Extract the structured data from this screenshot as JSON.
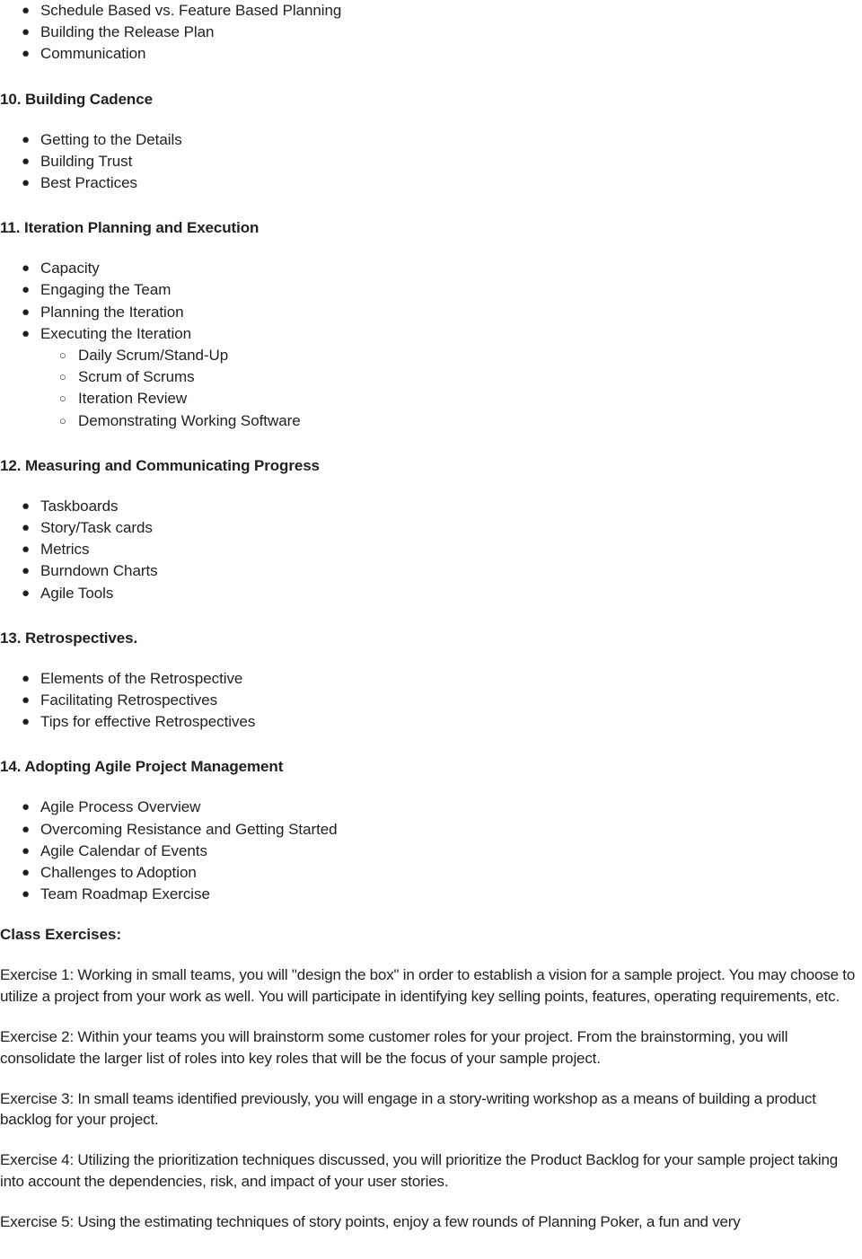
{
  "document": {
    "type": "course-outline-page",
    "bullet_glyph": "bullet-filled-circle",
    "subbullet_glyph": "bullet-hollow-circle",
    "text_color": "#231f20",
    "background_color": "#ffffff"
  },
  "top_list": {
    "items": [
      "Schedule Based vs. Feature Based Planning",
      "Building the Release Plan",
      "Communication"
    ]
  },
  "sections": [
    {
      "heading": "10. Building Cadence",
      "items": [
        "Getting to the Details",
        "Building Trust",
        "Best Practices"
      ]
    },
    {
      "heading": "11. Iteration Planning and Execution",
      "items": [
        "Capacity",
        "Engaging the Team",
        "Planning the Iteration",
        "Executing the Iteration"
      ],
      "subitems": [
        "Daily Scrum/Stand-Up",
        "Scrum of Scrums",
        "Iteration Review",
        "Demonstrating Working Software"
      ]
    },
    {
      "heading": "12. Measuring and Communicating Progress",
      "items": [
        "Taskboards",
        "Story/Task cards",
        "Metrics",
        "Burndown Charts",
        "Agile Tools"
      ]
    },
    {
      "heading": "13. Retrospectives.",
      "items": [
        "Elements of the Retrospective",
        "Facilitating Retrospectives",
        "Tips for effective Retrospectives"
      ]
    },
    {
      "heading": "14. Adopting Agile Project Management",
      "items": [
        "Agile Process Overview",
        "Overcoming Resistance and Getting Started",
        "Agile Calendar of Events",
        "Challenges to Adoption",
        "Team Roadmap Exercise"
      ]
    }
  ],
  "exercises": {
    "heading": "Class Exercises:",
    "items": [
      "Exercise 1: Working in small teams, you will \"design the box\" in order to establish a vision for a sample project. You may choose to utilize a project from your work as well. You will participate in identifying key selling points, features, operating requirements, etc.",
      "Exercise 2: Within your teams you will brainstorm some customer roles for your project. From the brainstorming, you will consolidate the larger list of roles into key roles that will be the focus of your sample project.",
      "Exercise 3: In small teams identified previously, you will engage in a story-writing workshop as a means of building a product backlog for your project.",
      "Exercise 4: Utilizing the prioritization techniques discussed, you will prioritize the Product Backlog for your sample project taking into account the dependencies, risk, and impact of your user stories.",
      "Exercise 5: Using the estimating techniques of story points, enjoy a few rounds of Planning Poker, a fun and very"
    ]
  }
}
